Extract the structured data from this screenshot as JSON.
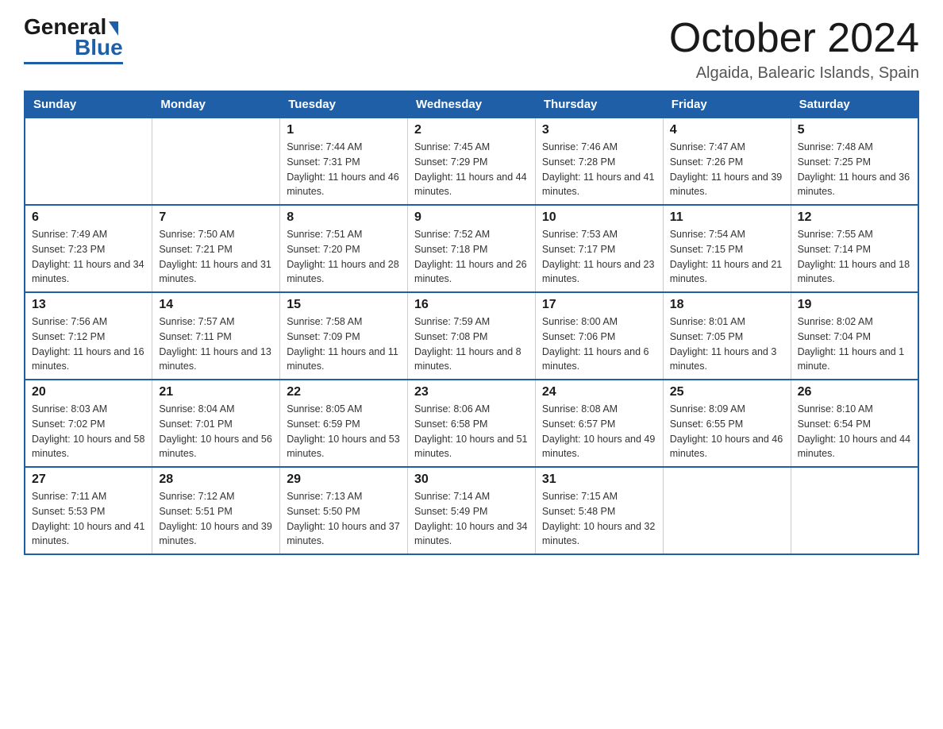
{
  "header": {
    "logo_general": "General",
    "logo_blue": "Blue",
    "month_title": "October 2024",
    "location": "Algaida, Balearic Islands, Spain"
  },
  "days_of_week": [
    "Sunday",
    "Monday",
    "Tuesday",
    "Wednesday",
    "Thursday",
    "Friday",
    "Saturday"
  ],
  "weeks": [
    [
      {
        "day": "",
        "sunrise": "",
        "sunset": "",
        "daylight": ""
      },
      {
        "day": "",
        "sunrise": "",
        "sunset": "",
        "daylight": ""
      },
      {
        "day": "1",
        "sunrise": "Sunrise: 7:44 AM",
        "sunset": "Sunset: 7:31 PM",
        "daylight": "Daylight: 11 hours and 46 minutes."
      },
      {
        "day": "2",
        "sunrise": "Sunrise: 7:45 AM",
        "sunset": "Sunset: 7:29 PM",
        "daylight": "Daylight: 11 hours and 44 minutes."
      },
      {
        "day": "3",
        "sunrise": "Sunrise: 7:46 AM",
        "sunset": "Sunset: 7:28 PM",
        "daylight": "Daylight: 11 hours and 41 minutes."
      },
      {
        "day": "4",
        "sunrise": "Sunrise: 7:47 AM",
        "sunset": "Sunset: 7:26 PM",
        "daylight": "Daylight: 11 hours and 39 minutes."
      },
      {
        "day": "5",
        "sunrise": "Sunrise: 7:48 AM",
        "sunset": "Sunset: 7:25 PM",
        "daylight": "Daylight: 11 hours and 36 minutes."
      }
    ],
    [
      {
        "day": "6",
        "sunrise": "Sunrise: 7:49 AM",
        "sunset": "Sunset: 7:23 PM",
        "daylight": "Daylight: 11 hours and 34 minutes."
      },
      {
        "day": "7",
        "sunrise": "Sunrise: 7:50 AM",
        "sunset": "Sunset: 7:21 PM",
        "daylight": "Daylight: 11 hours and 31 minutes."
      },
      {
        "day": "8",
        "sunrise": "Sunrise: 7:51 AM",
        "sunset": "Sunset: 7:20 PM",
        "daylight": "Daylight: 11 hours and 28 minutes."
      },
      {
        "day": "9",
        "sunrise": "Sunrise: 7:52 AM",
        "sunset": "Sunset: 7:18 PM",
        "daylight": "Daylight: 11 hours and 26 minutes."
      },
      {
        "day": "10",
        "sunrise": "Sunrise: 7:53 AM",
        "sunset": "Sunset: 7:17 PM",
        "daylight": "Daylight: 11 hours and 23 minutes."
      },
      {
        "day": "11",
        "sunrise": "Sunrise: 7:54 AM",
        "sunset": "Sunset: 7:15 PM",
        "daylight": "Daylight: 11 hours and 21 minutes."
      },
      {
        "day": "12",
        "sunrise": "Sunrise: 7:55 AM",
        "sunset": "Sunset: 7:14 PM",
        "daylight": "Daylight: 11 hours and 18 minutes."
      }
    ],
    [
      {
        "day": "13",
        "sunrise": "Sunrise: 7:56 AM",
        "sunset": "Sunset: 7:12 PM",
        "daylight": "Daylight: 11 hours and 16 minutes."
      },
      {
        "day": "14",
        "sunrise": "Sunrise: 7:57 AM",
        "sunset": "Sunset: 7:11 PM",
        "daylight": "Daylight: 11 hours and 13 minutes."
      },
      {
        "day": "15",
        "sunrise": "Sunrise: 7:58 AM",
        "sunset": "Sunset: 7:09 PM",
        "daylight": "Daylight: 11 hours and 11 minutes."
      },
      {
        "day": "16",
        "sunrise": "Sunrise: 7:59 AM",
        "sunset": "Sunset: 7:08 PM",
        "daylight": "Daylight: 11 hours and 8 minutes."
      },
      {
        "day": "17",
        "sunrise": "Sunrise: 8:00 AM",
        "sunset": "Sunset: 7:06 PM",
        "daylight": "Daylight: 11 hours and 6 minutes."
      },
      {
        "day": "18",
        "sunrise": "Sunrise: 8:01 AM",
        "sunset": "Sunset: 7:05 PM",
        "daylight": "Daylight: 11 hours and 3 minutes."
      },
      {
        "day": "19",
        "sunrise": "Sunrise: 8:02 AM",
        "sunset": "Sunset: 7:04 PM",
        "daylight": "Daylight: 11 hours and 1 minute."
      }
    ],
    [
      {
        "day": "20",
        "sunrise": "Sunrise: 8:03 AM",
        "sunset": "Sunset: 7:02 PM",
        "daylight": "Daylight: 10 hours and 58 minutes."
      },
      {
        "day": "21",
        "sunrise": "Sunrise: 8:04 AM",
        "sunset": "Sunset: 7:01 PM",
        "daylight": "Daylight: 10 hours and 56 minutes."
      },
      {
        "day": "22",
        "sunrise": "Sunrise: 8:05 AM",
        "sunset": "Sunset: 6:59 PM",
        "daylight": "Daylight: 10 hours and 53 minutes."
      },
      {
        "day": "23",
        "sunrise": "Sunrise: 8:06 AM",
        "sunset": "Sunset: 6:58 PM",
        "daylight": "Daylight: 10 hours and 51 minutes."
      },
      {
        "day": "24",
        "sunrise": "Sunrise: 8:08 AM",
        "sunset": "Sunset: 6:57 PM",
        "daylight": "Daylight: 10 hours and 49 minutes."
      },
      {
        "day": "25",
        "sunrise": "Sunrise: 8:09 AM",
        "sunset": "Sunset: 6:55 PM",
        "daylight": "Daylight: 10 hours and 46 minutes."
      },
      {
        "day": "26",
        "sunrise": "Sunrise: 8:10 AM",
        "sunset": "Sunset: 6:54 PM",
        "daylight": "Daylight: 10 hours and 44 minutes."
      }
    ],
    [
      {
        "day": "27",
        "sunrise": "Sunrise: 7:11 AM",
        "sunset": "Sunset: 5:53 PM",
        "daylight": "Daylight: 10 hours and 41 minutes."
      },
      {
        "day": "28",
        "sunrise": "Sunrise: 7:12 AM",
        "sunset": "Sunset: 5:51 PM",
        "daylight": "Daylight: 10 hours and 39 minutes."
      },
      {
        "day": "29",
        "sunrise": "Sunrise: 7:13 AM",
        "sunset": "Sunset: 5:50 PM",
        "daylight": "Daylight: 10 hours and 37 minutes."
      },
      {
        "day": "30",
        "sunrise": "Sunrise: 7:14 AM",
        "sunset": "Sunset: 5:49 PM",
        "daylight": "Daylight: 10 hours and 34 minutes."
      },
      {
        "day": "31",
        "sunrise": "Sunrise: 7:15 AM",
        "sunset": "Sunset: 5:48 PM",
        "daylight": "Daylight: 10 hours and 32 minutes."
      },
      {
        "day": "",
        "sunrise": "",
        "sunset": "",
        "daylight": ""
      },
      {
        "day": "",
        "sunrise": "",
        "sunset": "",
        "daylight": ""
      }
    ]
  ]
}
